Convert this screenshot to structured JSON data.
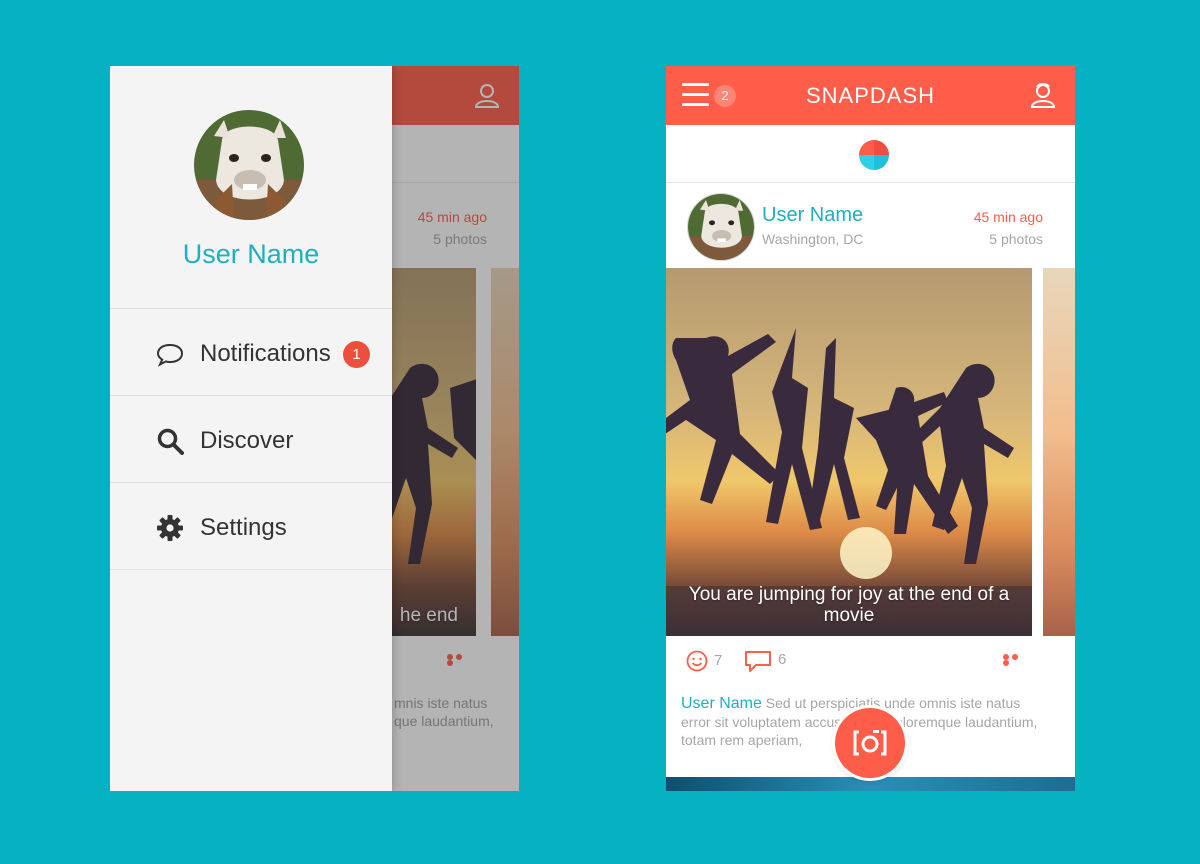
{
  "app": {
    "title": "SNAPDASH",
    "menu_badge": "2"
  },
  "colors": {
    "accent": "#fe5d49",
    "teal": "#1eafc0",
    "background": "#06b1c2"
  },
  "drawer": {
    "user_name": "User Name",
    "items": [
      {
        "label": "Notifications",
        "icon": "speech-bubble-icon",
        "badge": "1"
      },
      {
        "label": "Discover",
        "icon": "search-icon"
      },
      {
        "label": "Settings",
        "icon": "gear-icon"
      }
    ]
  },
  "post": {
    "user_name": "User Name",
    "location": "Washington, DC",
    "time": "45 min ago",
    "photos": "5 photos",
    "caption": "You are jumping for joy at the end of a movie",
    "smiles": "7",
    "comments": "6",
    "author": "User Name",
    "text": "Sed ut perspiciatis unde omnis iste natus error sit voluptatem accusantium doloremque laudantium, totam rem aperiam,"
  },
  "left_preview": {
    "time": "45 min ago",
    "photos": "5 photos",
    "caption_fragment": "he end",
    "text_line1": "mnis iste natus",
    "text_line2": "que laudantium,"
  },
  "icons": {
    "menu": "hamburger-icon",
    "friends": "people-icon",
    "story": "story-dot-icon",
    "smile": "smile-icon",
    "comment": "comment-icon",
    "more": "more-dots-icon",
    "camera": "camera-icon"
  }
}
